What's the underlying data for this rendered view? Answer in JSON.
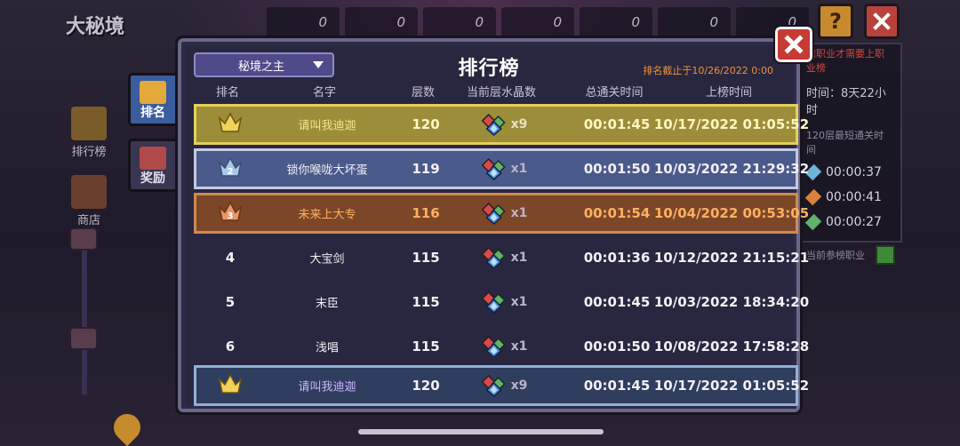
{
  "background": {
    "title": "大秘境",
    "top_counts": [
      "0",
      "0",
      "0",
      "0",
      "0",
      "0",
      "0"
    ]
  },
  "left_nav": {
    "items": [
      {
        "label": "排行榜"
      },
      {
        "label": "商店"
      }
    ]
  },
  "side_tabs": {
    "rank": "排名",
    "reward": "奖励"
  },
  "right_panel": {
    "note": "需职业才需要上职业榜",
    "time_label": "时间：8天22小时",
    "best_label": "120层最短通关时间",
    "times": [
      {
        "time": "00:00:37",
        "color": "#6fb3d8"
      },
      {
        "time": "00:00:41",
        "color": "#d8823a"
      },
      {
        "time": "00:00:27",
        "color": "#5fb36a"
      }
    ],
    "footer": "当前参榜职业"
  },
  "panel": {
    "dropdown": "秘境之主",
    "title": "排行榜",
    "cutoff": "排名截止于10/26/2022 0:00",
    "headers": {
      "rank": "排名",
      "name": "名字",
      "floor": "层数",
      "crystal": "当前层水晶数",
      "clear": "总通关时间",
      "date": "上榜时间"
    },
    "rows": [
      {
        "rank": "1",
        "style": "r1",
        "name": "请叫我迪迦",
        "floor": "120",
        "crystal": "x9",
        "clear": "00:01:45",
        "date": "10/17/2022 01:05:52"
      },
      {
        "rank": "2",
        "style": "r2",
        "name": "锁你喉咙大坏蛋",
        "floor": "119",
        "crystal": "x1",
        "clear": "00:01:50",
        "date": "10/03/2022 21:29:32"
      },
      {
        "rank": "3",
        "style": "r3",
        "name": "未来上大专",
        "floor": "116",
        "crystal": "x1",
        "clear": "00:01:54",
        "date": "10/04/2022 00:53:05"
      },
      {
        "rank": "4",
        "style": "plain",
        "name": "大宝剑",
        "floor": "115",
        "crystal": "x1",
        "clear": "00:01:36",
        "date": "10/12/2022 21:15:21"
      },
      {
        "rank": "5",
        "style": "plain",
        "name": "末臣",
        "floor": "115",
        "crystal": "x1",
        "clear": "00:01:45",
        "date": "10/03/2022 18:34:20"
      },
      {
        "rank": "6",
        "style": "plain",
        "name": "浅唱",
        "floor": "115",
        "crystal": "x1",
        "clear": "00:01:50",
        "date": "10/08/2022 17:58:28"
      }
    ],
    "my_row": {
      "rank": "1",
      "name": "请叫我迪迦",
      "floor": "120",
      "crystal": "x9",
      "clear": "00:01:45",
      "date": "10/17/2022 01:05:52"
    }
  },
  "colors": {
    "gold": "#e6cf58",
    "silver": "#c3c9e2",
    "bronze": "#d08a50",
    "accent_orange": "#f0933a"
  },
  "icons": {
    "help": "?",
    "close": "close-icon",
    "crystal": "crystal-icon",
    "crown": "crown-icon"
  }
}
